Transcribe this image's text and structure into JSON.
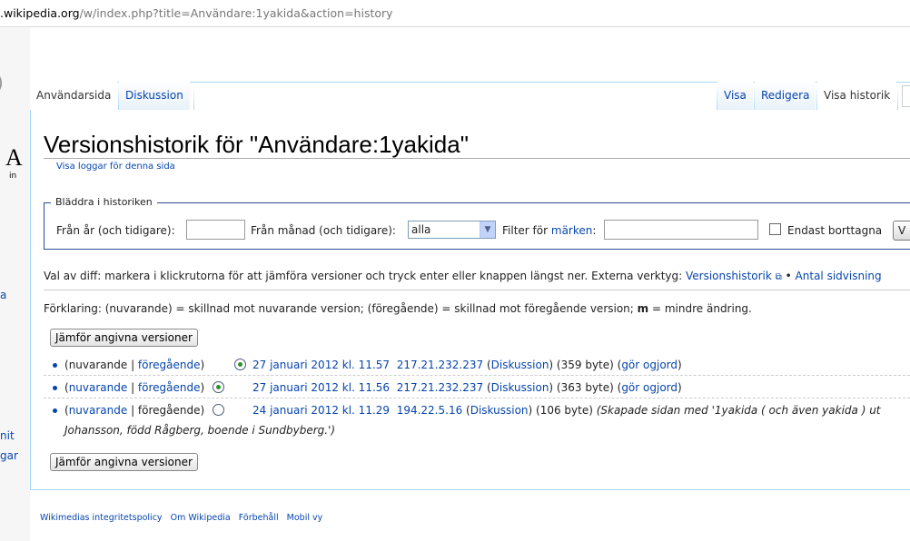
{
  "browser": {
    "url_domain": ".wikipedia.org",
    "url_path": "/w/index.php?title=Användare:1yakida&action=history"
  },
  "sidebar": {
    "frag_logo": "A",
    "frag_logo_sub": "in",
    "frag1": "a",
    "frag2": "nit",
    "frag3": "gar"
  },
  "tabs": {
    "user_page": "Användarsida",
    "discussion": "Diskussion",
    "view": "Visa",
    "edit": "Redigera",
    "history": "Visa historik"
  },
  "page": {
    "title": "Versionshistorik för \"Användare:1yakida\"",
    "view_logs": "Visa loggar för denna sida"
  },
  "browse": {
    "legend": "Bläddra i historiken",
    "year_label": "Från år (och tidigare):",
    "year_value": "",
    "month_label": "Från månad (och tidigare):",
    "month_value": "alla",
    "filter_label": "Filter för",
    "filter_link": "märken",
    "filter_colon": ":",
    "filter_value": "",
    "deleted_label": "Endast borttagna",
    "show_button": "V"
  },
  "diff_help": {
    "text": "Val av diff: markera i klickrutorna för att jämföra versioner och tryck enter eller knappen längst ner. Externa verktyg:",
    "tool1": "Versionshistorik",
    "sep": "•",
    "tool2": "Antal sidvisning"
  },
  "legend_text": {
    "part1": "Förklaring: (nuvarande) = skillnad mot nuvarande version; (föregående) = skillnad mot föregående version;",
    "m": "m",
    "part2": "= mindre ändring."
  },
  "compare_button": "Jämför angivna versioner",
  "history": [
    {
      "cur": "nuvarande",
      "prev": "föregående",
      "date": "27 januari 2012 kl. 11.57",
      "user": "217.21.232.237",
      "talk": "Diskussion",
      "size": "(359 byte)",
      "undo": "gör ogjord"
    },
    {
      "cur": "nuvarande",
      "prev": "föregående",
      "date": "27 januari 2012 kl. 11.56",
      "user": "217.21.232.237",
      "talk": "Diskussion",
      "size": "(363 byte)",
      "undo": "gör ogjord"
    },
    {
      "cur": "nuvarande",
      "prev": "föregående",
      "date": "24 januari 2012 kl. 11.29",
      "user": "194.22.5.16",
      "talk": "Diskussion",
      "size": "(106 byte)",
      "summary1": "(Skapade sidan med '1yakida ( och även yakida ) ut",
      "summary2": "Johansson, född Rågberg, boende i Sundbyberg.')"
    }
  ],
  "footer": {
    "privacy": "Wikimedias integritetspolicy",
    "about": "Om Wikipedia",
    "disclaimer": "Förbehåll",
    "mobile": "Mobil vy"
  }
}
